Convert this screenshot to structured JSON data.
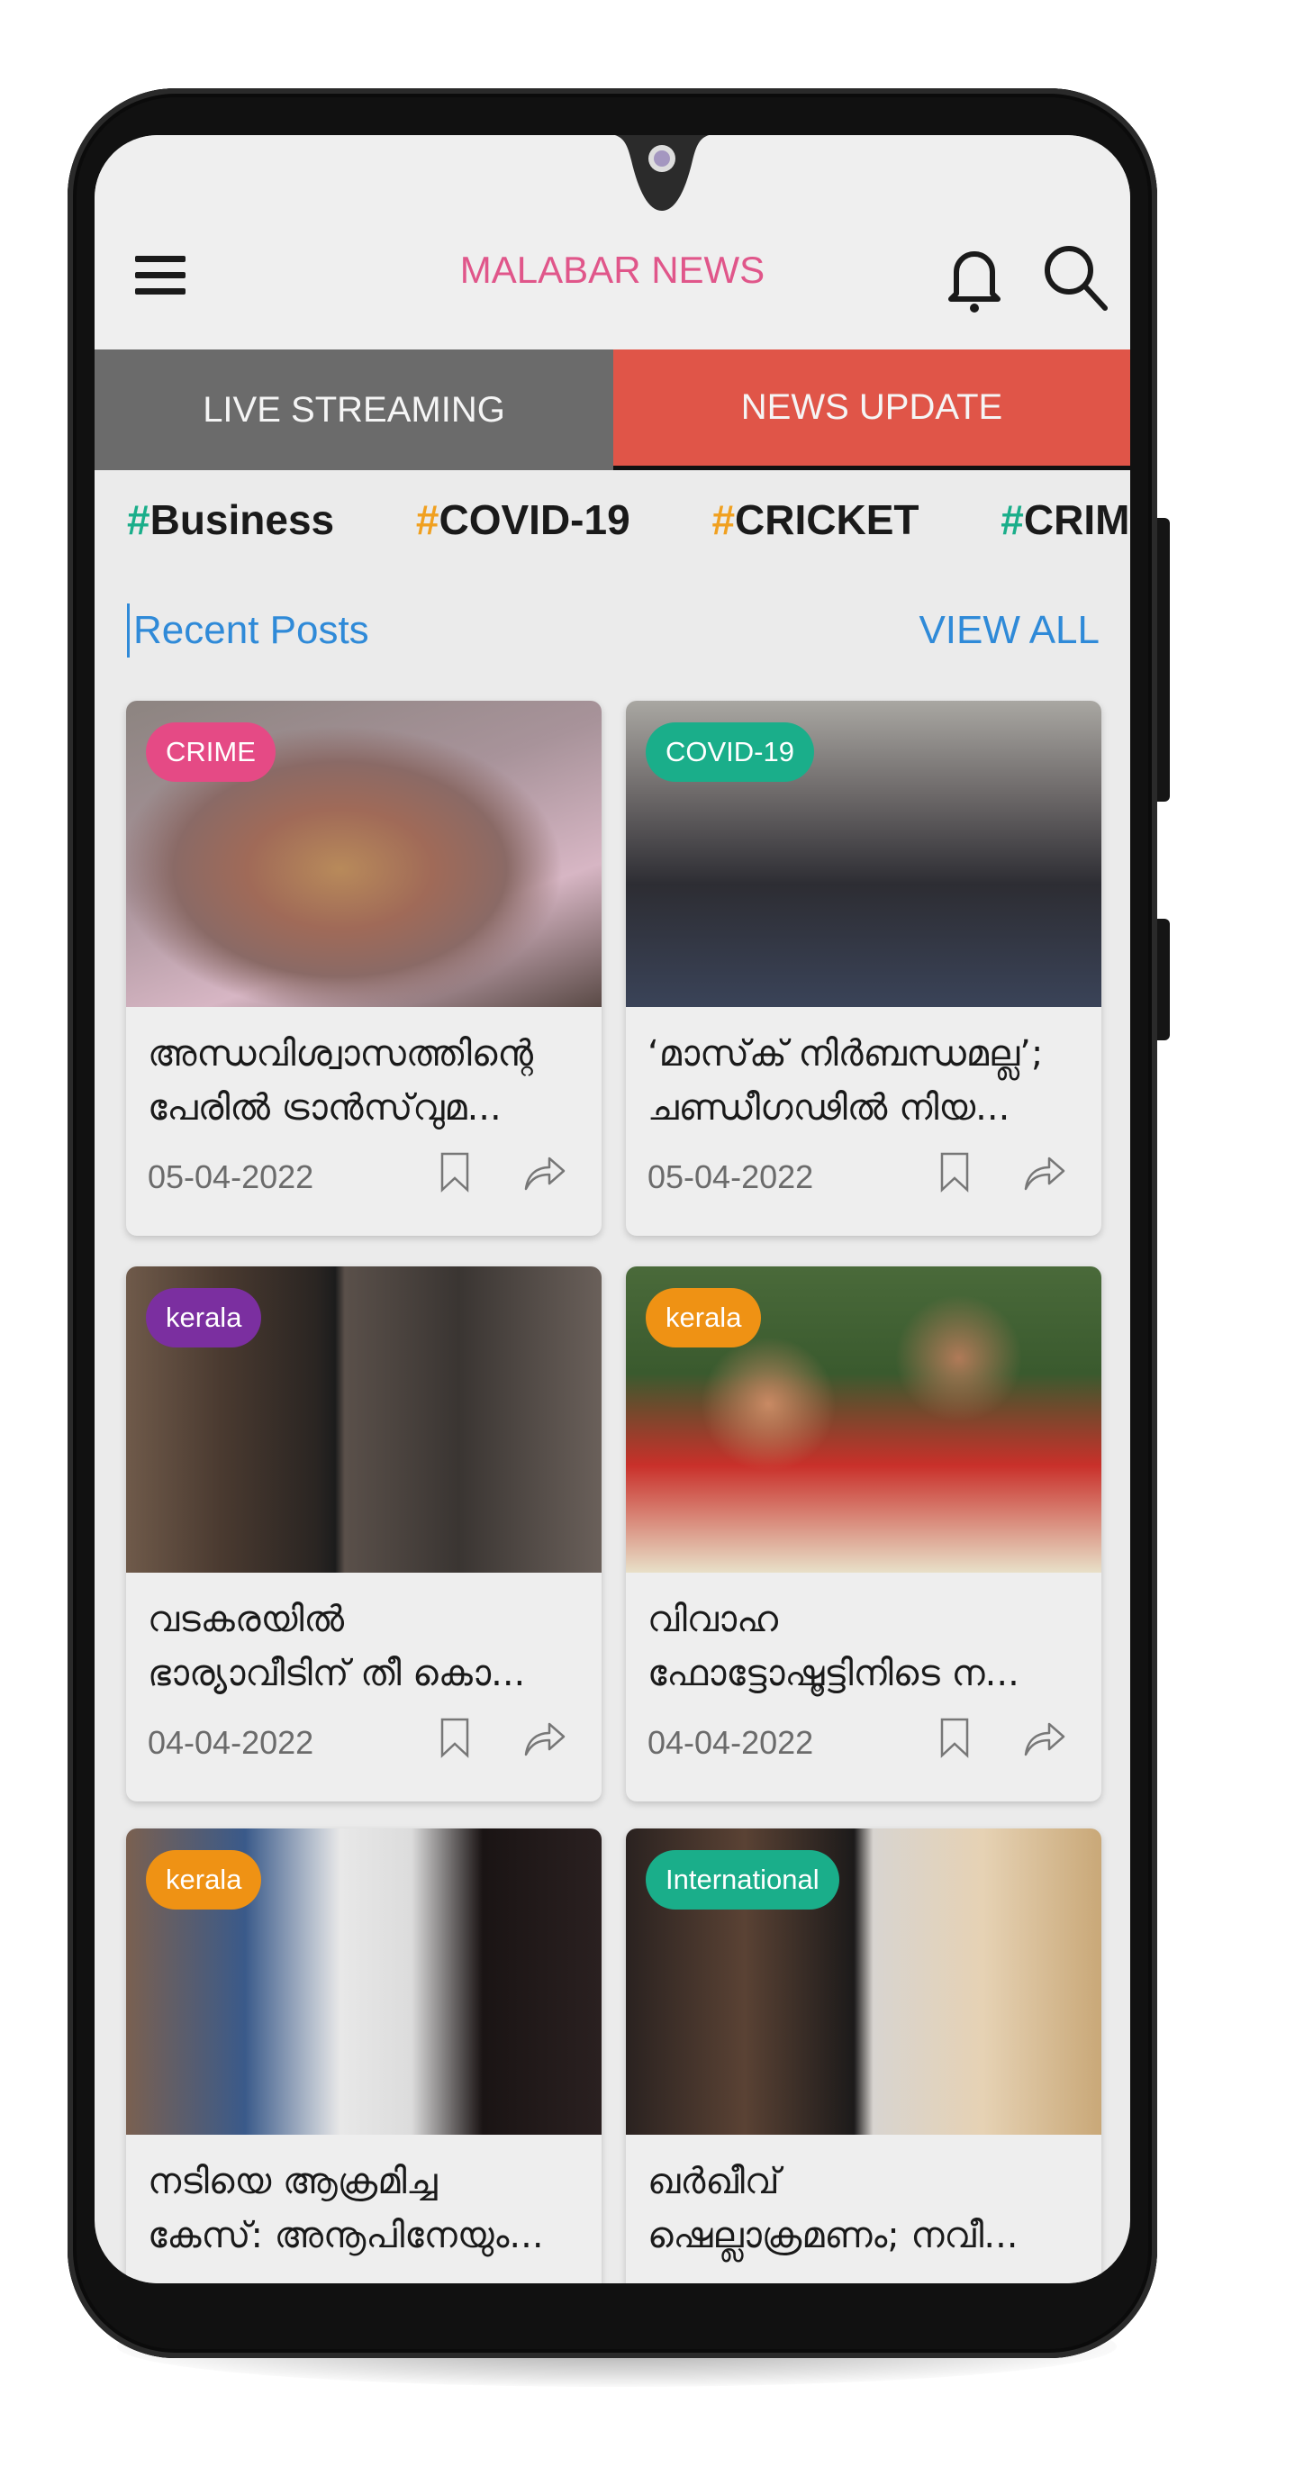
{
  "header": {
    "app_title": "MALABAR NEWS",
    "menu_icon": "hamburger-menu-icon",
    "notification_icon": "bell-icon",
    "search_icon": "search-icon"
  },
  "tabs": [
    {
      "label": "LIVE STREAMING",
      "active": false
    },
    {
      "label": "NEWS UPDATE",
      "active": true
    }
  ],
  "hashtags": [
    {
      "hash": "#",
      "label": "Business",
      "hash_color": "#1aae8a"
    },
    {
      "hash": "#",
      "label": "COVID-19",
      "hash_color": "#f0a020"
    },
    {
      "hash": "#",
      "label": "CRICKET",
      "hash_color": "#f0a020"
    },
    {
      "hash": "#",
      "label": "CRIME",
      "hash_color": "#1aae8a"
    }
  ],
  "recent_posts": {
    "title": "Recent Posts",
    "view_all_label": "VIEW ALL",
    "posts": [
      {
        "category": "CRIME",
        "badge_color": "#e54a85",
        "title_line1": "അന്ധവിശ്വാസത്തിന്റെ",
        "title_line2": "പേരിൽ ട്രാൻസ്‌വുമ...",
        "date": "05-04-2022"
      },
      {
        "category": "COVID-19",
        "badge_color": "#1aae8a",
        "title_line1": "‘മാസ്‌ക് നിർബന്ധമല്ല’;",
        "title_line2": "ചണ്ഡീഗഢിൽ നിയ...",
        "date": "05-04-2022"
      },
      {
        "category": "kerala",
        "badge_color": "#7b2fa0",
        "title_line1": "വടകരയിൽ",
        "title_line2": "ഭാര്യാവീടിന് തീ കൊ...",
        "date": "04-04-2022"
      },
      {
        "category": "kerala",
        "badge_color": "#ef9214",
        "title_line1": "വിവാഹ",
        "title_line2": "ഫോട്ടോഷൂട്ടിനിടെ ന...",
        "date": "04-04-2022"
      },
      {
        "category": "kerala",
        "badge_color": "#ef9214",
        "title_line1": "നടിയെ ആക്രമിച്ച",
        "title_line2": "കേസ്: അനൂപിനേയും...",
        "date": ""
      },
      {
        "category": "International",
        "badge_color": "#1aae8a",
        "title_line1": "ഖർഖീവ്",
        "title_line2": "ഷെല്ലാക്രമണം; നവീ...",
        "date": ""
      }
    ]
  },
  "colors": {
    "brand": "#e0568a",
    "tab_inactive": "#6b6b6b",
    "tab_active": "#e05548",
    "link": "#2f8ad8"
  }
}
